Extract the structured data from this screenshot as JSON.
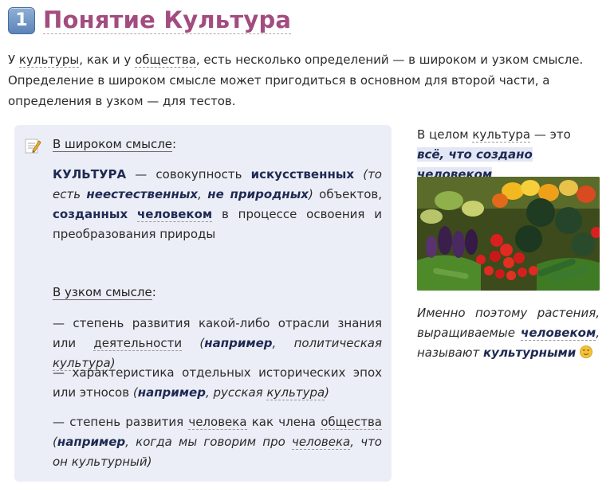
{
  "header": {
    "number": "1",
    "title": "Понятие Культура"
  },
  "intro": {
    "t1": "У ",
    "w1": "культуры",
    "t2": ", как и у ",
    "w2": "общества",
    "t3": ", есть несколько определений — в широком и узком смысле. Определение в широком смысле может пригодиться в основном для второй части, а определения в узком — для тестов."
  },
  "broad": {
    "label": "В широком смысле",
    "colon": ":",
    "term": "КУЛЬТУРА",
    "t1": " — совокупность ",
    "b1": "искусственных",
    "i1": " (то есть ",
    "bi1": "неестественных",
    "i2": ", ",
    "bi2": "не природных",
    "i3": ")",
    "t2": " объектов, ",
    "b2": "созданных",
    "t3": " ",
    "b3": "человеком",
    "t4": " в процессе освоения и преобразования природы"
  },
  "narrow": {
    "label": "В узком смысле",
    "colon": ":",
    "items": [
      {
        "t": "— степень развития какой-либо отрасли знания или ",
        "u": "деятельности",
        "op": " (",
        "ex": "например",
        "rest": ", политическая ",
        "u2": "культура",
        "cl": ")"
      },
      {
        "t": "— характеристика отдельных исторических эпох или этносов",
        "op": " (",
        "ex": "например",
        "rest": ", русская ",
        "u2": "культура",
        "cl": ")"
      },
      {
        "t": "— степень развития ",
        "u": "человека",
        "t2": " как члена ",
        "u3": "общества",
        "op": " (",
        "ex": "например",
        "rest": ", когда мы говорим про ",
        "u2": "человека",
        "rest2": ", что он культурный",
        "cl": ")"
      }
    ]
  },
  "right": {
    "t1": "В целом ",
    "u1": "культура",
    "t2": " — это ",
    "b1": "всё, что создано ",
    "b2": "человеком",
    "t3": "."
  },
  "caption": {
    "t1": "Именно поэтому растения, выращиваемые ",
    "b1": "человеком",
    "t2": ", называют ",
    "b2": "культурными"
  }
}
